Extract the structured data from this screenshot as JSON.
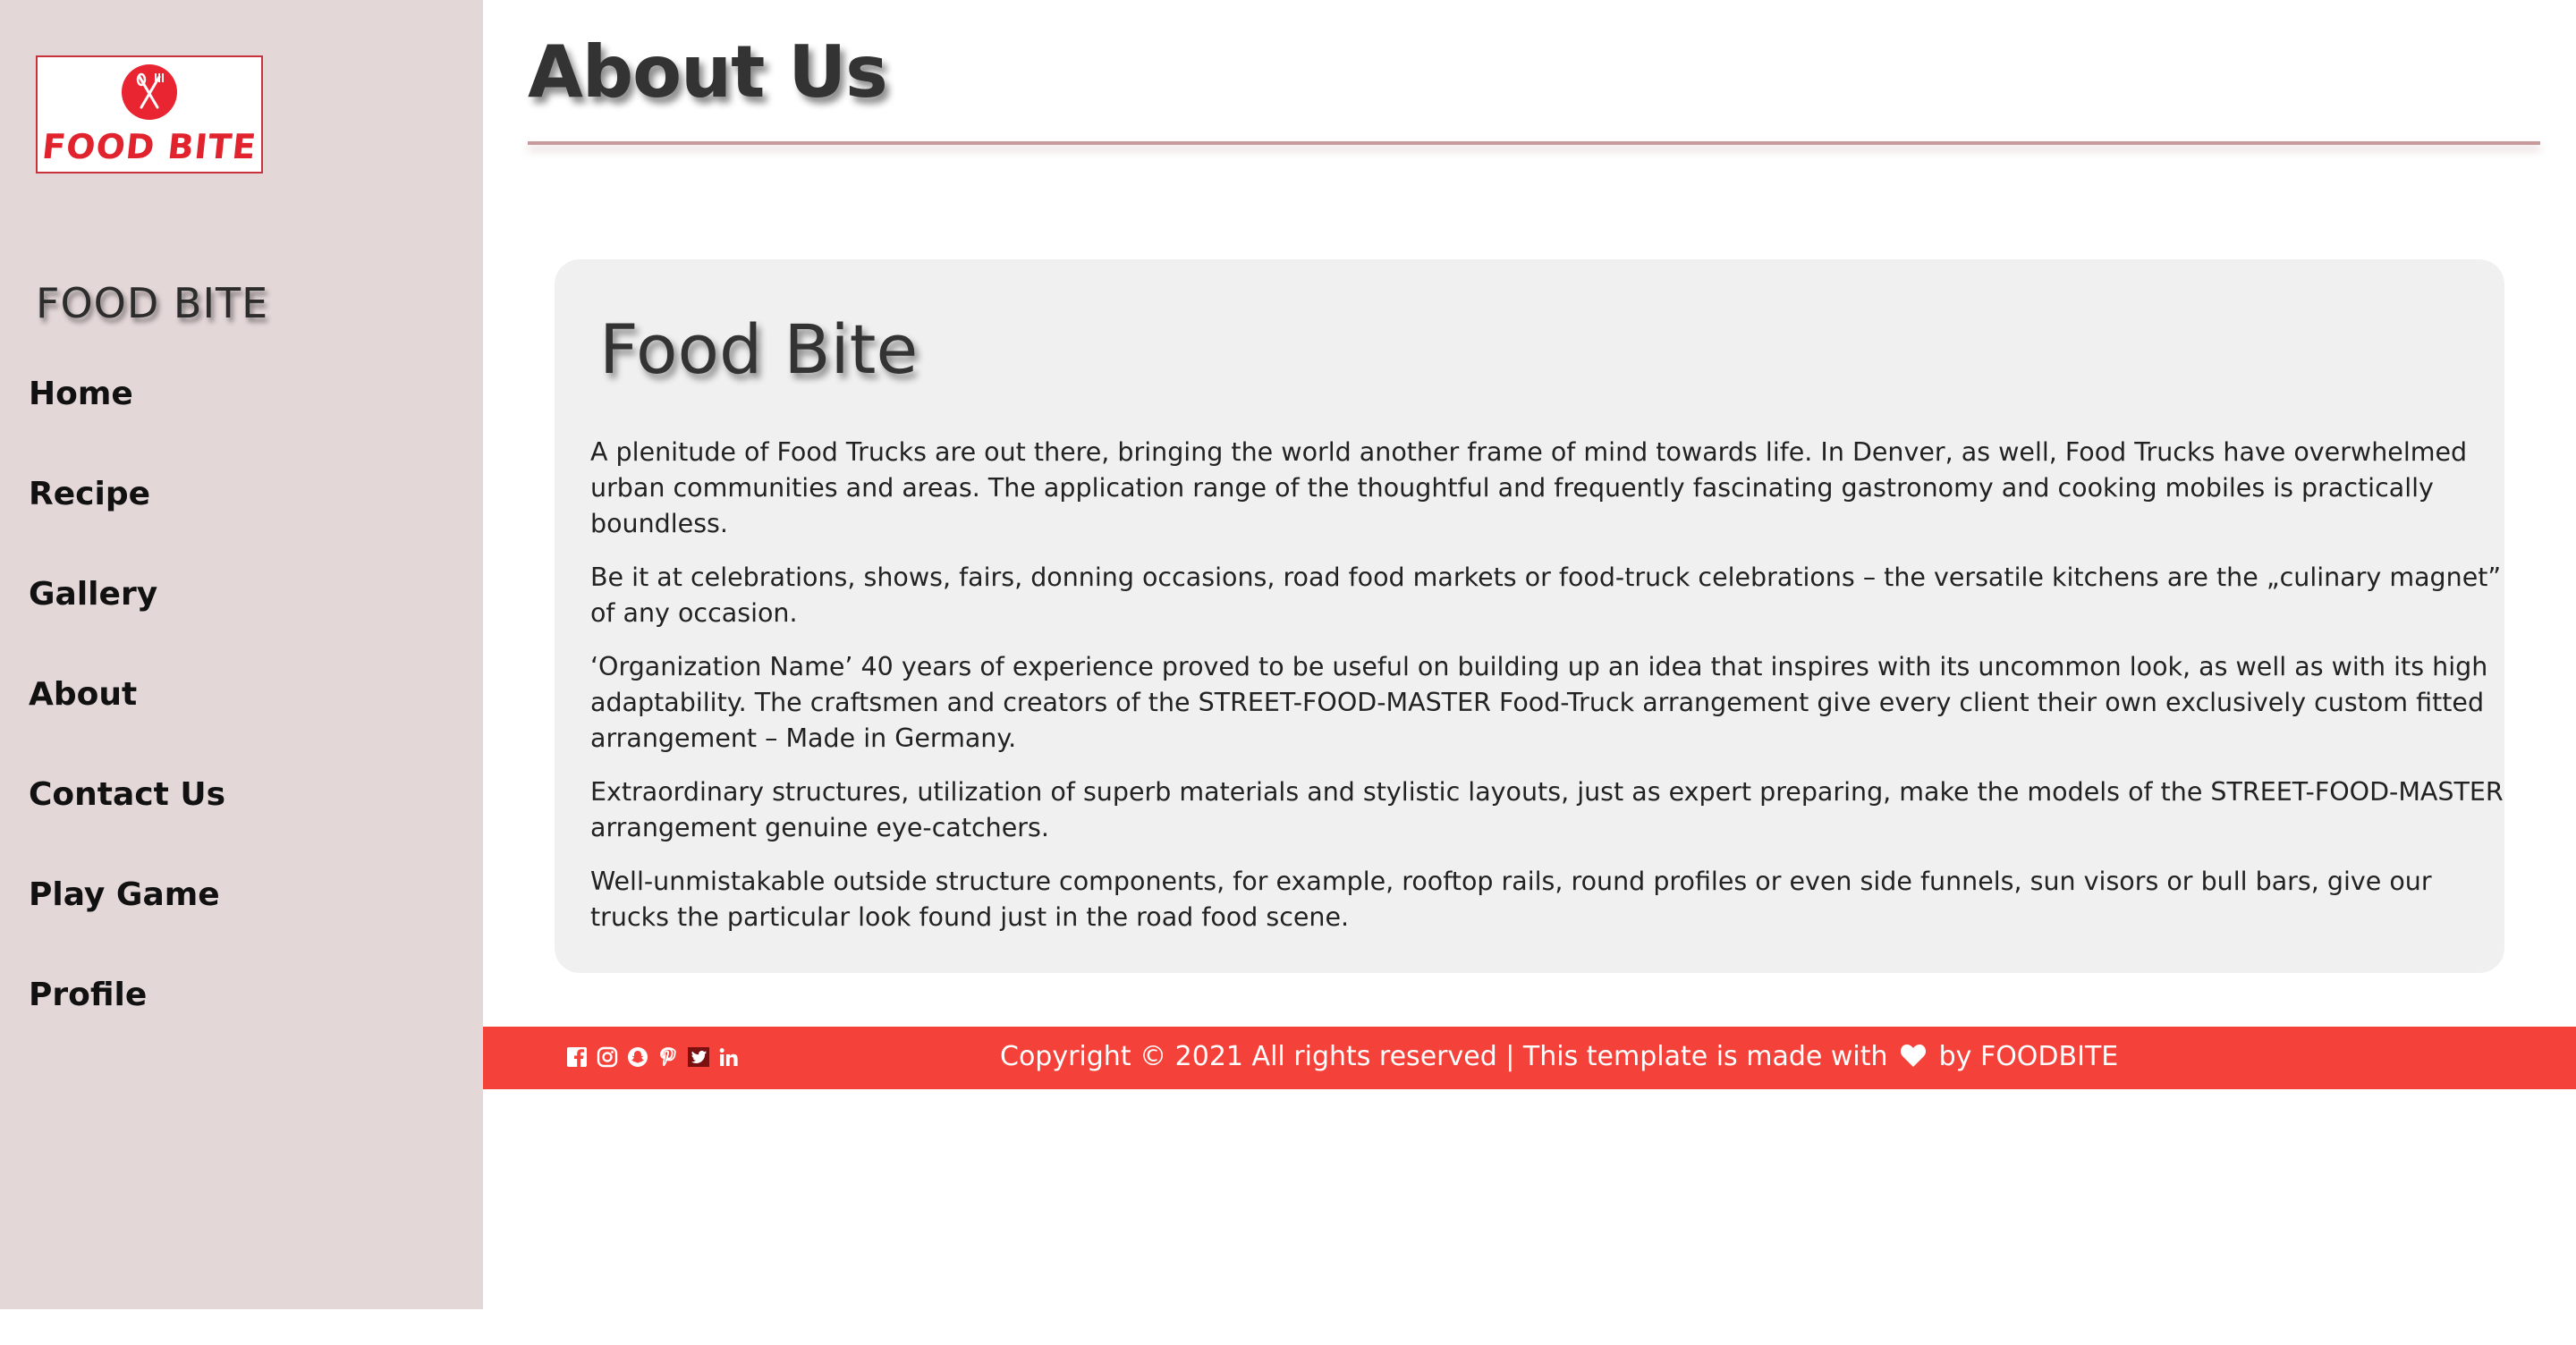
{
  "sidebar": {
    "logo_text": "FOOD BITE",
    "brand": "FOOD BITE",
    "nav": [
      {
        "label": "Home"
      },
      {
        "label": "Recipe"
      },
      {
        "label": "Gallery"
      },
      {
        "label": "About"
      },
      {
        "label": "Contact Us"
      },
      {
        "label": "Play Game"
      },
      {
        "label": "Profile"
      }
    ]
  },
  "header": {
    "title": "About Us"
  },
  "card": {
    "title": "Food Bite",
    "paragraphs": [
      "A plenitude of Food Trucks are out there, bringing the world another frame of mind towards life. In Denver, as well, Food Trucks have overwhelmed urban communities and areas. The application range of the thoughtful and frequently fascinating gastronomy and cooking mobiles is practically boundless.",
      "Be it at celebrations, shows, fairs, donning occasions, road food markets or food-truck celebrations – the versatile kitchens are the „culinary magnet” of any occasion.",
      "‘Organization Name’ 40 years of experience proved to be useful on building up an idea that inspires with its uncommon look, as well as with its high adaptability. The craftsmen and creators of the STREET-FOOD-MASTER Food-Truck arrangement give every client their own exclusively custom fitted arrangement – Made in Germany.",
      "Extraordinary structures, utilization of superb materials and stylistic layouts, just as expert preparing, make the models of the STREET-FOOD-MASTER arrangement genuine eye-catchers.",
      "Well-unmistakable outside structure components, for example, rooftop rails, round profiles or even side funnels, sun visors or bull bars, give our trucks the particular look found just in the road food scene."
    ]
  },
  "footer": {
    "copyright_prefix": "Copyright © 2021 All rights reserved | This template is made with",
    "copyright_suffix": "by FOODBITE",
    "social": [
      "facebook-icon",
      "instagram-icon",
      "snapchat-icon",
      "pinterest-icon",
      "twitter-icon",
      "linkedin-icon"
    ]
  },
  "colors": {
    "sidebar_bg": "#e4d7d8",
    "footer_bg": "#f4423a",
    "card_bg": "#f0f0f0",
    "logo_red": "#e0232d"
  }
}
